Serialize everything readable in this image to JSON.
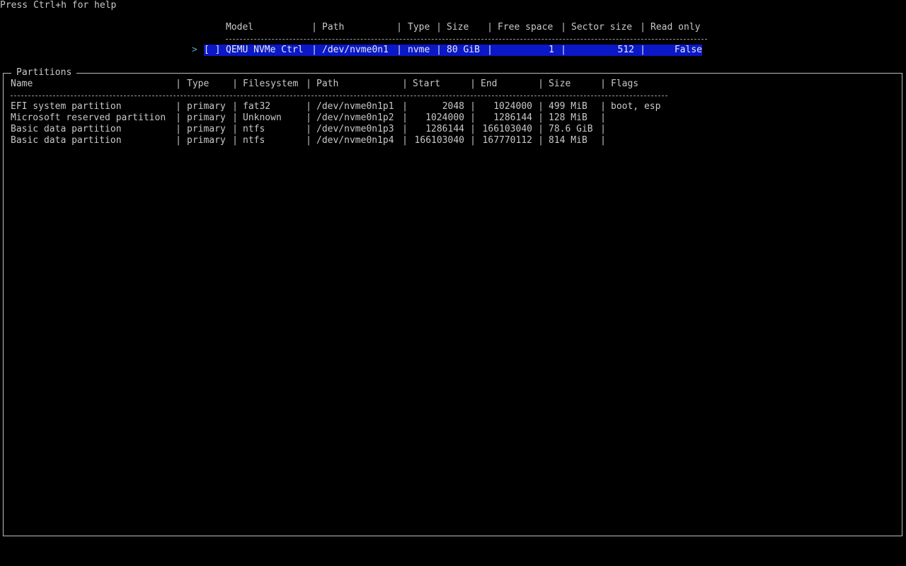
{
  "help_text": "Press Ctrl+h for help",
  "devices": {
    "headers": [
      "Model",
      "Path",
      "Type",
      "Size",
      "Free space",
      "Sector size",
      "Read only"
    ],
    "rows": [
      {
        "cursor": ">",
        "checkbox": "[ ]",
        "model": "QEMU NVMe Ctrl",
        "path": "/dev/nvme0n1",
        "type": "nvme",
        "size": "80 GiB",
        "free_space": "1",
        "sector_size": "512",
        "read_only": "False",
        "selected": true
      }
    ]
  },
  "partitions": {
    "title": "Partitions",
    "headers": [
      "Name",
      "Type",
      "Filesystem",
      "Path",
      "Start",
      "End",
      "Size",
      "Flags"
    ],
    "rows": [
      {
        "name": "EFI system partition",
        "type": "primary",
        "filesystem": "fat32",
        "path": "/dev/nvme0n1p1",
        "start": "2048",
        "end": "1024000",
        "size": "499 MiB",
        "flags": "boot, esp"
      },
      {
        "name": "Microsoft reserved partition",
        "type": "primary",
        "filesystem": "Unknown",
        "path": "/dev/nvme0n1p2",
        "start": "1024000",
        "end": "1286144",
        "size": "128 MiB",
        "flags": ""
      },
      {
        "name": "Basic data partition",
        "type": "primary",
        "filesystem": "ntfs",
        "path": "/dev/nvme0n1p3",
        "start": "1286144",
        "end": "166103040",
        "size": "78.6 GiB",
        "flags": ""
      },
      {
        "name": "Basic data partition",
        "type": "primary",
        "filesystem": "ntfs",
        "path": "/dev/nvme0n1p4",
        "start": "166103040",
        "end": "167770112",
        "size": "814 MiB",
        "flags": ""
      }
    ]
  },
  "colors": {
    "background": "#000000",
    "text": "#c8c8c8",
    "selection": "#0a18c8",
    "cursor": "#5aa3c8"
  }
}
